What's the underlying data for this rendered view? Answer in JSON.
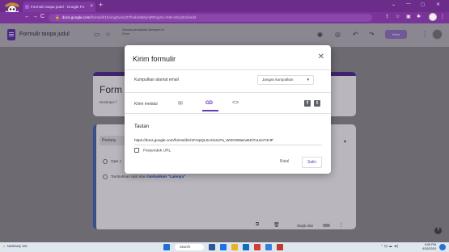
{
  "browser": {
    "tab_title": "Formulir tanpa judul - Google Fo",
    "new_tab": "+",
    "tab_close": "×",
    "window_controls": [
      "⌄",
      "—",
      "◻",
      "✕"
    ],
    "nav": [
      "←",
      "→",
      "C"
    ],
    "lock": "🔒",
    "url_host": "docs.google.com",
    "url_path": "/forms/d/1hxmgZunssZ7fsafuMWyHjRRsgXo-zH9-ADcyl51k/edit",
    "addr_icons": [
      "⇪",
      "☆",
      "▣",
      "✱",
      "⋮"
    ]
  },
  "app": {
    "title": "Formulir tanpa judul",
    "folder_icon": "▭",
    "star_icon": "☆",
    "save_status": "Semua perubahan disimpan di Drive",
    "toolbar_icons": [
      "◉",
      "◎",
      "↶",
      "↷"
    ],
    "send_label": "Kirim",
    "more_icon": "⋮"
  },
  "form": {
    "title": "Form",
    "description": "Deskripsi f",
    "question_placeholder": "Pertany",
    "option1": "Opsi 1",
    "add_option": "Tambahkan opsi",
    "or": "atau",
    "add_other": "tambahkan \"Lainnya\"",
    "footer_icons": [
      "⧉",
      "🗑"
    ],
    "required_label": "Wajib diisi",
    "more_icon": "⋮",
    "dropdown_icon": "▾"
  },
  "modal": {
    "title": "Kirim formulir",
    "close": "✕",
    "collect_email_label": "Kumpulkan alamat email",
    "collect_email_value": "Jangan kumpulkan",
    "caret": "▾",
    "send_via_label": "Kirim melalui",
    "send_icons": {
      "email": "✉",
      "link": "GD",
      "embed": "<>"
    },
    "social": {
      "facebook": "f",
      "twitter": "t"
    },
    "link_section_label": "Tautan",
    "link_value": "https://docs.google.com/forms/d/e/1FAIpQLScXiv2LPa_WOGW8wna5Ki7uUsnT4HP",
    "shorten_label": "Perpendek URL",
    "cancel_label": "Batal",
    "copy_label": "Salin"
  },
  "help": "?",
  "taskbar": {
    "weather": "NASDAQ 100",
    "weather_sub": "+1.03%",
    "search_label": "Search",
    "tray": "⌃ ⊡ ☁ ◄)",
    "time": "9:00 PM",
    "date": "4/26/2024"
  }
}
